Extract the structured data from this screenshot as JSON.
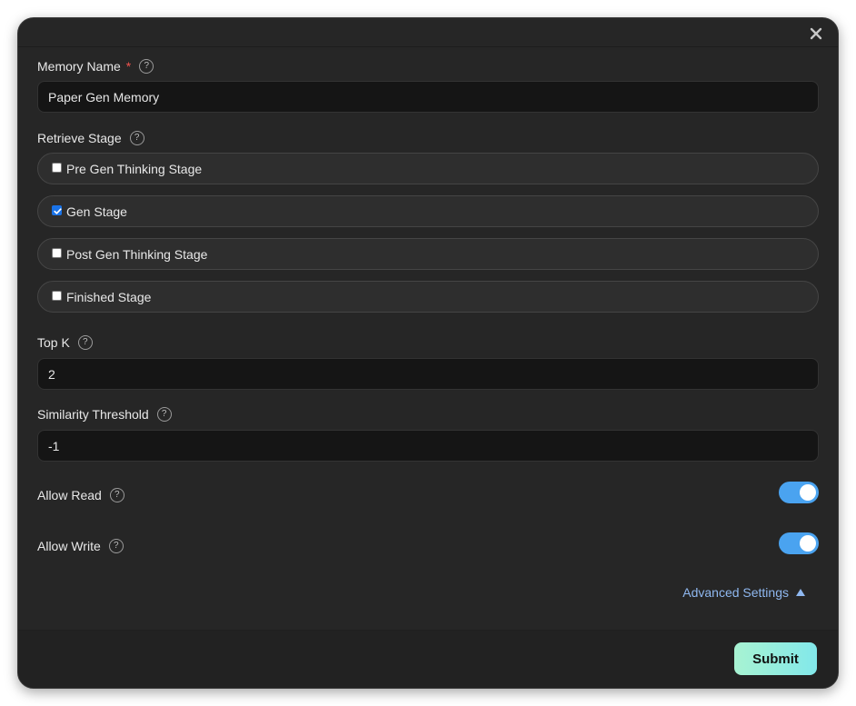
{
  "dialog": {
    "close_icon": "close-icon",
    "memory_name": {
      "label": "Memory Name",
      "required_mark": "*",
      "help": "?",
      "value": "Paper Gen Memory"
    },
    "retrieve_stage": {
      "label": "Retrieve Stage",
      "help": "?",
      "options": [
        {
          "label": "Pre Gen Thinking Stage",
          "checked": false
        },
        {
          "label": "Gen Stage",
          "checked": true
        },
        {
          "label": "Post Gen Thinking Stage",
          "checked": false
        },
        {
          "label": "Finished Stage",
          "checked": false
        }
      ]
    },
    "top_k": {
      "label": "Top K",
      "help": "?",
      "value": "2"
    },
    "similarity_threshold": {
      "label": "Similarity Threshold",
      "help": "?",
      "value": "-1"
    },
    "allow_read": {
      "label": "Allow Read",
      "help": "?",
      "enabled": true
    },
    "allow_write": {
      "label": "Allow Write",
      "help": "?",
      "enabled": true
    },
    "advanced_settings": {
      "label": "Advanced Settings",
      "expanded": true
    },
    "submit_label": "Submit"
  },
  "colors": {
    "background": "#262626",
    "input_background": "#151515",
    "toggle_on": "#4aa3f0",
    "link": "#8fb8f0",
    "required": "#f0524d",
    "submit_gradient_start": "#a8f3d2",
    "submit_gradient_end": "#82e8ea"
  }
}
